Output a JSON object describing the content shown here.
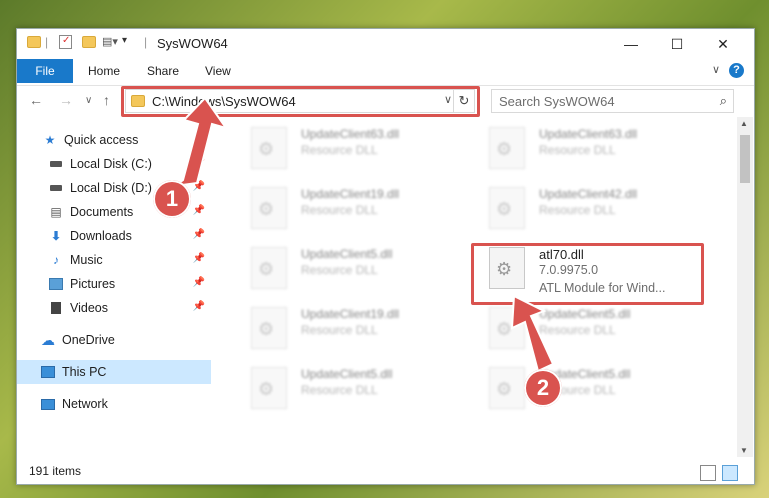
{
  "window": {
    "title": "SysWOW64",
    "controls": {
      "minimize": "—",
      "maximize": "☐",
      "close": "✕"
    }
  },
  "ribbon": {
    "tabs": [
      "File",
      "Home",
      "Share",
      "View"
    ],
    "help": "?",
    "collapse": "∨"
  },
  "navbar": {
    "back": "←",
    "forward": "→",
    "recent": "∨",
    "up": "↑",
    "address": "C:\\Windows\\SysWOW64",
    "refresh": "↻",
    "search_placeholder": "Search SysWOW64"
  },
  "sidebar": {
    "items": [
      {
        "label": "Quick access",
        "icon": "star-icon"
      },
      {
        "label": "Local Disk (C:)",
        "icon": "disk-icon",
        "pinned": true
      },
      {
        "label": "Local Disk (D:)",
        "icon": "disk-icon",
        "pinned": true
      },
      {
        "label": "Documents",
        "icon": "documents-icon",
        "pinned": true
      },
      {
        "label": "Downloads",
        "icon": "download-icon",
        "pinned": true
      },
      {
        "label": "Music",
        "icon": "music-icon",
        "pinned": true
      },
      {
        "label": "Pictures",
        "icon": "pictures-icon",
        "pinned": true
      },
      {
        "label": "Videos",
        "icon": "videos-icon",
        "pinned": true
      },
      {
        "label": "OneDrive",
        "icon": "cloud-icon"
      },
      {
        "label": "This PC",
        "icon": "computer-icon",
        "selected": true
      },
      {
        "label": "Network",
        "icon": "network-icon"
      }
    ]
  },
  "files": [
    {
      "name": "UpdateClient63.dll",
      "desc": "Resource DLL"
    },
    {
      "name": "UpdateClient63.dll",
      "desc": "Resource DLL"
    },
    {
      "name": "UpdateClient19.dll",
      "desc": "Resource DLL"
    },
    {
      "name": "UpdateClient42.dll",
      "desc": "Resource DLL"
    },
    {
      "name": "UpdateClient5.dll",
      "desc": "Resource DLL"
    },
    {
      "name": "atl70.dll",
      "version": "7.0.9975.0",
      "desc": "ATL Module for Wind..."
    },
    {
      "name": "UpdateClient19.dll",
      "desc": "Resource DLL"
    },
    {
      "name": "UpdateClient5.dll",
      "desc": "Resource DLL"
    },
    {
      "name": "UpdateClient5.dll",
      "desc": "Resource DLL"
    },
    {
      "name": "UpdateClient5.dll",
      "desc": "Resource DLL"
    }
  ],
  "status": {
    "item_count": "191 items"
  },
  "annotations": {
    "step1": "1",
    "step2": "2",
    "color": "#d9534f"
  }
}
